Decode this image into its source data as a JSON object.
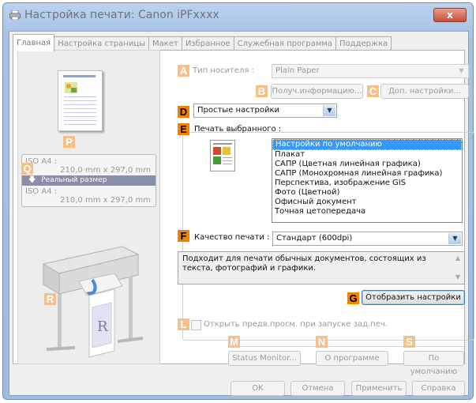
{
  "window": {
    "title": "Настройка печати: Canon iPFxxxx",
    "close_label": "x"
  },
  "tabs": [
    {
      "label": "Главная",
      "active": true
    },
    {
      "label": "Настройка страницы"
    },
    {
      "label": "Макет"
    },
    {
      "label": "Избранное"
    },
    {
      "label": "Служебная программа"
    },
    {
      "label": "Поддержка"
    }
  ],
  "callouts": {
    "A": "A",
    "B": "B",
    "C": "C",
    "D": "D",
    "E": "E",
    "F": "F",
    "G": "G",
    "L": "L",
    "M": "M",
    "N": "N",
    "P": "P",
    "Q": "Q",
    "R": "R",
    "S": "S"
  },
  "preview": {
    "from_size": "ISO A4 :",
    "from_dims": "210,0 mm x 297,0 mm",
    "scale_label": "Реальный размер",
    "to_size": "ISO A4 :",
    "to_dims": "210,0 mm x 297,0 mm"
  },
  "media_type": {
    "label": "Тип носителя :",
    "value": "Plain Paper"
  },
  "buttons": {
    "get_info": "Получ.информацию...",
    "advanced_settings": "Доп. настройки...",
    "show_settings": "Отобразить настройки",
    "status_monitor": "Status Monitor...",
    "about": "О программе",
    "defaults": "По умолчанию",
    "ok": "OK",
    "cancel": "Отмена",
    "apply": "Применить",
    "help": "Справка"
  },
  "mode_select": {
    "value": "Простые настройки"
  },
  "print_target": {
    "label": "Печать выбранного :",
    "items": [
      "Настройки по умолчанию",
      "Плакат",
      "САПР (Цветная линейная графика)",
      "САПР (Монохромная линейная графика)",
      "Перспектива, изображение GIS",
      "Фото (Цветной)",
      "Офисный документ",
      "Точная цетопередача"
    ],
    "selected_index": 0
  },
  "print_quality": {
    "label": "Качество печати :",
    "value": "Стандарт (600dpi)"
  },
  "description": "Подходит для печати обычных документов, состоящих из текста, фотографий и графики.",
  "preview_checkbox": {
    "label": "Открыть предв.просм. при запуске зад.печ.",
    "checked": false
  },
  "colors": {
    "callout_dark": "#f08200",
    "callout_light": "#f5c08a",
    "selection": "#3399ff"
  }
}
